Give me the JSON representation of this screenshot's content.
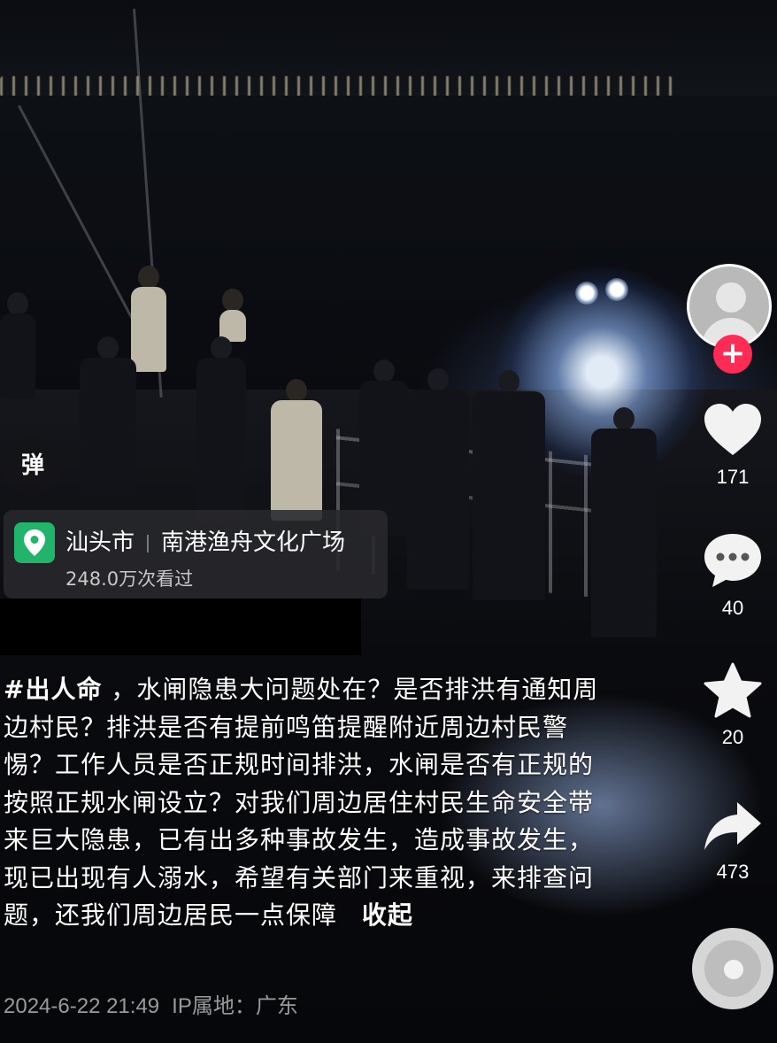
{
  "location": {
    "city": "汕头市",
    "place": "南港渔舟文化广场",
    "views": "248.0万次看过"
  },
  "danmu_label": "弹",
  "actions": {
    "likes": "171",
    "comments": "40",
    "favorites": "20",
    "shares": "473"
  },
  "caption": {
    "hashtag": "#出人命",
    "text": "，水闸隐患大问题处在？是否排洪有通知周边村民？排洪是否有提前鸣笛提醒附近周边村民警惕？工作人员是否正规时间排洪，水闸是否有正规的按照正规水闸设立？对我们周边居住村民生命安全带来巨大隐患，已有出多种事故发生，造成事故发生，现已出现有人溺水，希望有关部门来重视，来排查问题，还我们周边居民一点保障",
    "collapse_label": "收起"
  },
  "meta": {
    "datetime": "2024-6-22 21:49",
    "ip_location": "IP属地：广东"
  },
  "icons": {
    "location": "location-pin-icon",
    "like": "heart-icon",
    "comment": "comment-bubble-icon",
    "favorite": "star-icon",
    "share": "share-arrow-icon",
    "music": "music-disc-icon"
  },
  "colors": {
    "follow_button": "#fe2c55",
    "location_pin": "#20b56a"
  }
}
